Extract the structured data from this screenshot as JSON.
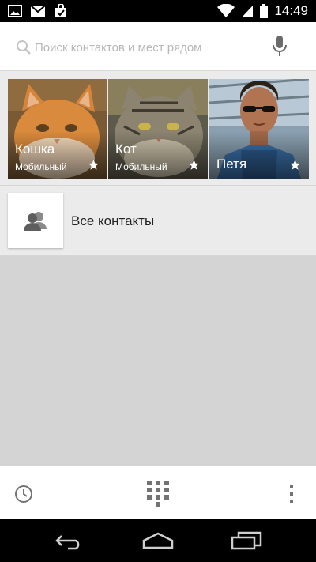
{
  "status_bar": {
    "time": "14:49"
  },
  "search": {
    "placeholder": "Поиск контактов и мест рядом",
    "value": ""
  },
  "favorites": [
    {
      "name": "Кошка",
      "phone_type": "Мобильный",
      "starred": true
    },
    {
      "name": "Кот",
      "phone_type": "Мобильный",
      "starred": true
    },
    {
      "name": "Петя",
      "phone_type": "",
      "starred": true
    }
  ],
  "all_contacts": {
    "label": "Все контакты"
  },
  "colors": {
    "accent_gray": "#737373",
    "background": "#ebebeb",
    "empty_area": "#d4d4d4"
  }
}
